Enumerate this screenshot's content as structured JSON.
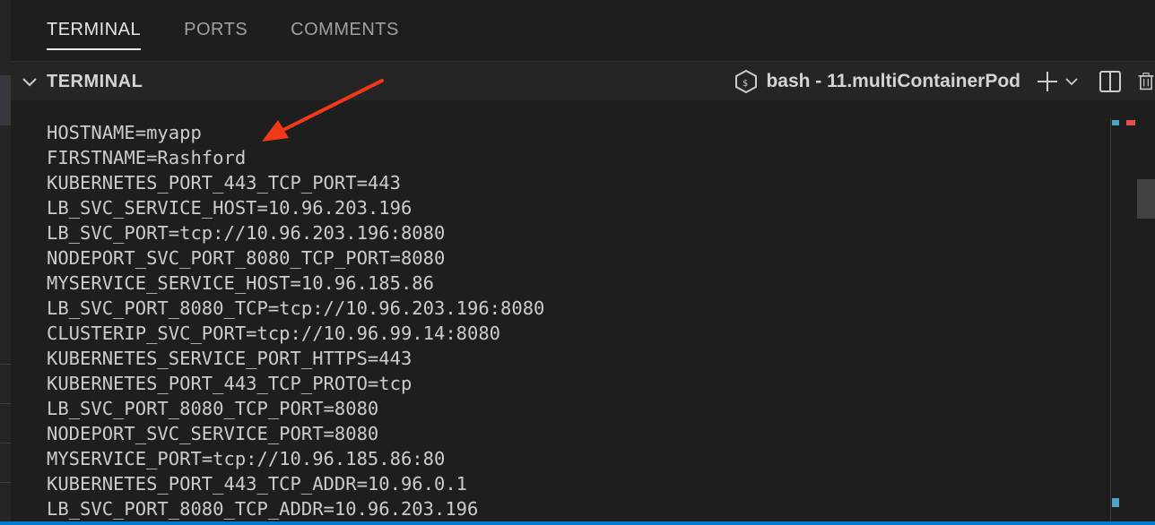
{
  "panel": {
    "tabs": [
      {
        "label": "TERMINAL",
        "active": true
      },
      {
        "label": "PORTS",
        "active": false
      },
      {
        "label": "COMMENTS",
        "active": false
      }
    ]
  },
  "terminal": {
    "section_title": "TERMINAL",
    "shell_label": "bash - 11.multiContainerPod",
    "icons": {
      "collapse": "chevron-down-icon",
      "shell": "terminal-shell-icon",
      "new_terminal": "plus-icon",
      "launch_profile": "chevron-down-icon",
      "split": "split-icon",
      "kill": "trash-icon"
    },
    "lines": [
      "HOSTNAME=myapp",
      "FIRSTNAME=Rashford",
      "KUBERNETES_PORT_443_TCP_PORT=443",
      "LB_SVC_SERVICE_HOST=10.96.203.196",
      "LB_SVC_PORT=tcp://10.96.203.196:8080",
      "NODEPORT_SVC_PORT_8080_TCP_PORT=8080",
      "MYSERVICE_SERVICE_HOST=10.96.185.86",
      "LB_SVC_PORT_8080_TCP=tcp://10.96.203.196:8080",
      "CLUSTERIP_SVC_PORT=tcp://10.96.99.14:8080",
      "KUBERNETES_SERVICE_PORT_HTTPS=443",
      "KUBERNETES_PORT_443_TCP_PROTO=tcp",
      "LB_SVC_PORT_8080_TCP_PORT=8080",
      "NODEPORT_SVC_SERVICE_PORT=8080",
      "MYSERVICE_PORT=tcp://10.96.185.86:80",
      "KUBERNETES_PORT_443_TCP_ADDR=10.96.0.1",
      "LB_SVC_PORT_8080_TCP_ADDR=10.96.203.196"
    ]
  },
  "colors": {
    "background": "#1e1e1e",
    "header": "#252526",
    "text": "#cccccc",
    "accent": "#007acc",
    "annotation_arrow": "#f03a17"
  }
}
